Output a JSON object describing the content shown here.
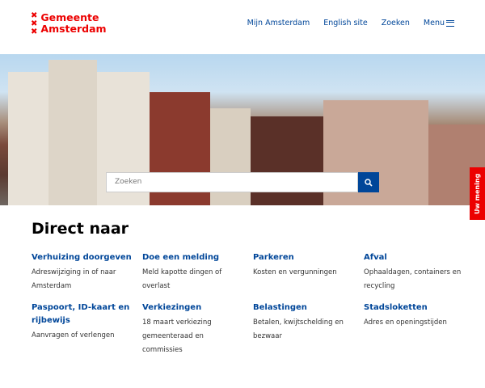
{
  "header": {
    "logo": [
      "Gemeente",
      "Amsterdam"
    ],
    "nav": [
      "Mijn Amsterdam",
      "English site",
      "Zoeken",
      "Menu"
    ]
  },
  "search": {
    "placeholder": "Zoeken"
  },
  "feedback": "Uw mening",
  "section_title": "Direct naar",
  "links": [
    {
      "title": "Verhuizing doorgeven",
      "desc": "Adreswijziging in of naar Amsterdam"
    },
    {
      "title": "Doe een melding",
      "desc": "Meld kapotte dingen of overlast"
    },
    {
      "title": "Parkeren",
      "desc": "Kosten en vergunningen"
    },
    {
      "title": "Afval",
      "desc": "Ophaaldagen, containers en recycling"
    },
    {
      "title": "Paspoort, ID-kaart en rijbewijs",
      "desc": "Aanvragen of verlengen"
    },
    {
      "title": "Verkiezingen",
      "desc": "18 maart verkiezing gemeenteraad en commissies"
    },
    {
      "title": "Belastingen",
      "desc": "Betalen, kwijtschelding en bezwaar"
    },
    {
      "title": "Stadsloketten",
      "desc": "Adres en openingstijden"
    }
  ]
}
